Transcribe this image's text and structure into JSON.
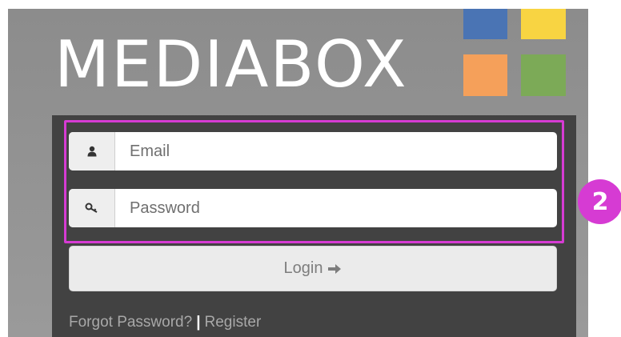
{
  "logo": {
    "text": "MEDIABOX",
    "colors": {
      "blue": "#4a74b4",
      "yellow": "#f8d442",
      "orange": "#f5a05a",
      "green": "#7caa57"
    }
  },
  "form": {
    "email": {
      "icon": "user-icon",
      "placeholder": "Email",
      "value": ""
    },
    "password": {
      "icon": "key-icon",
      "placeholder": "Password",
      "value": ""
    },
    "login": {
      "label": "Login",
      "icon": "arrow-right-icon"
    }
  },
  "footer_links": {
    "forgot": "Forgot Password?",
    "separator": "|",
    "register": "Register"
  },
  "annotation": {
    "step": "2",
    "highlight_color": "#d63bd3"
  }
}
